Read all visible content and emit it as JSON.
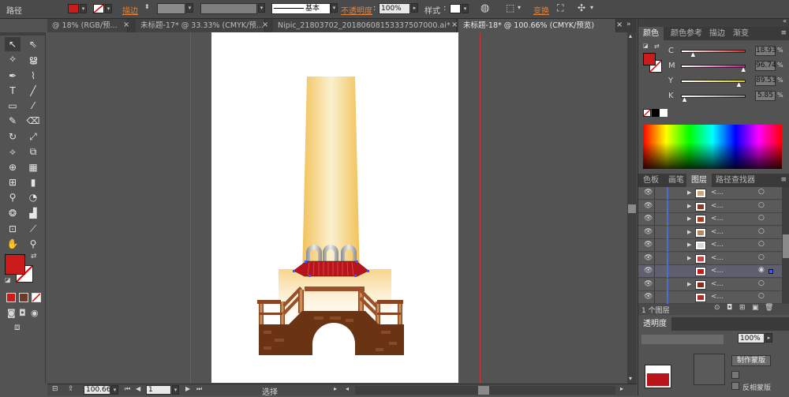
{
  "control_bar": {
    "object_type": "路径",
    "stroke_label": "描边",
    "stroke_style": "基本",
    "opacity_label": "不透明度",
    "opacity_value": "100%",
    "style_label": "样式",
    "transform_label": "变换",
    "fill_color": "#cc1b1b"
  },
  "doc_tabs": [
    {
      "label": "@ 18% (RGB/预...",
      "active": false
    },
    {
      "label": "未标题-17* @ 33.33% (CMYK/预...",
      "active": false
    },
    {
      "label": "Nipic_21803702_20180608153337507000.ai*",
      "active": false
    },
    {
      "label": "未标题-18* @ 100.66% (CMYK/预览)",
      "active": true
    }
  ],
  "toolbar": {
    "fill_color": "#cc1b1b",
    "tools": [
      "selection-tool",
      "direct-selection-tool",
      "magic-wand-tool",
      "lasso-tool",
      "pen-tool",
      "curvature-tool",
      "type-tool",
      "line-tool",
      "rectangle-tool",
      "paintbrush-tool",
      "pencil-tool",
      "eraser-tool",
      "rotate-tool",
      "scale-tool",
      "width-tool",
      "free-transform-tool",
      "shape-builder-tool",
      "perspective-grid-tool",
      "mesh-tool",
      "gradient-tool",
      "eyedropper-tool",
      "blend-tool",
      "symbol-sprayer-tool",
      "column-graph-tool",
      "artboard-tool",
      "slice-tool",
      "hand-tool",
      "zoom-tool"
    ]
  },
  "status_bar": {
    "zoom": "100.66",
    "artboard_number": "1",
    "tool_label": "选择"
  },
  "color_panel": {
    "tabs": [
      "颜色",
      "颜色参考",
      "描边",
      "渐变"
    ],
    "channels": [
      {
        "letter": "C",
        "value": "18.93",
        "fraction": 0.19,
        "color": "#d12a2a"
      },
      {
        "letter": "M",
        "value": "96.74",
        "fraction": 0.97,
        "color": "#c2138a"
      },
      {
        "letter": "Y",
        "value": "89.53",
        "fraction": 0.9,
        "color": "#d6c31a"
      },
      {
        "letter": "K",
        "value": "5.85",
        "fraction": 0.06,
        "color": "#8a8a8a"
      }
    ],
    "current_color": "#cc1b1b"
  },
  "layers_panel": {
    "tabs": [
      "色板",
      "画笔",
      "图层",
      "路径查找器"
    ],
    "rows": [
      {
        "label": "<...",
        "thumb": "#c9a97a",
        "expandable": true,
        "selected": false,
        "targeted": false
      },
      {
        "label": "<...",
        "thumb": "#8b3a2a",
        "expandable": true,
        "selected": false,
        "targeted": false
      },
      {
        "label": "<...",
        "thumb": "#a83e1e",
        "expandable": true,
        "selected": false,
        "targeted": false
      },
      {
        "label": "<...",
        "thumb": "#b48660",
        "expandable": true,
        "selected": false,
        "targeted": false
      },
      {
        "label": "<...",
        "thumb": "#d8d8d8",
        "expandable": true,
        "selected": false,
        "targeted": false
      },
      {
        "label": "<...",
        "thumb": "#c44",
        "expandable": true,
        "selected": false,
        "targeted": false
      },
      {
        "label": "<...",
        "thumb": "#c41c1c",
        "expandable": false,
        "selected": true,
        "targeted": true
      },
      {
        "label": "<...",
        "thumb": "#8a2a1a",
        "expandable": true,
        "selected": false,
        "targeted": false
      },
      {
        "label": "<...",
        "thumb": "#a8302a",
        "expandable": false,
        "selected": false,
        "targeted": false
      }
    ],
    "footer": "1 个图层"
  },
  "transparency_panel": {
    "title": "透明度",
    "opacity": "100%",
    "make_mask_label": "制作蒙版",
    "invert_mask_label": "反相蒙版"
  }
}
